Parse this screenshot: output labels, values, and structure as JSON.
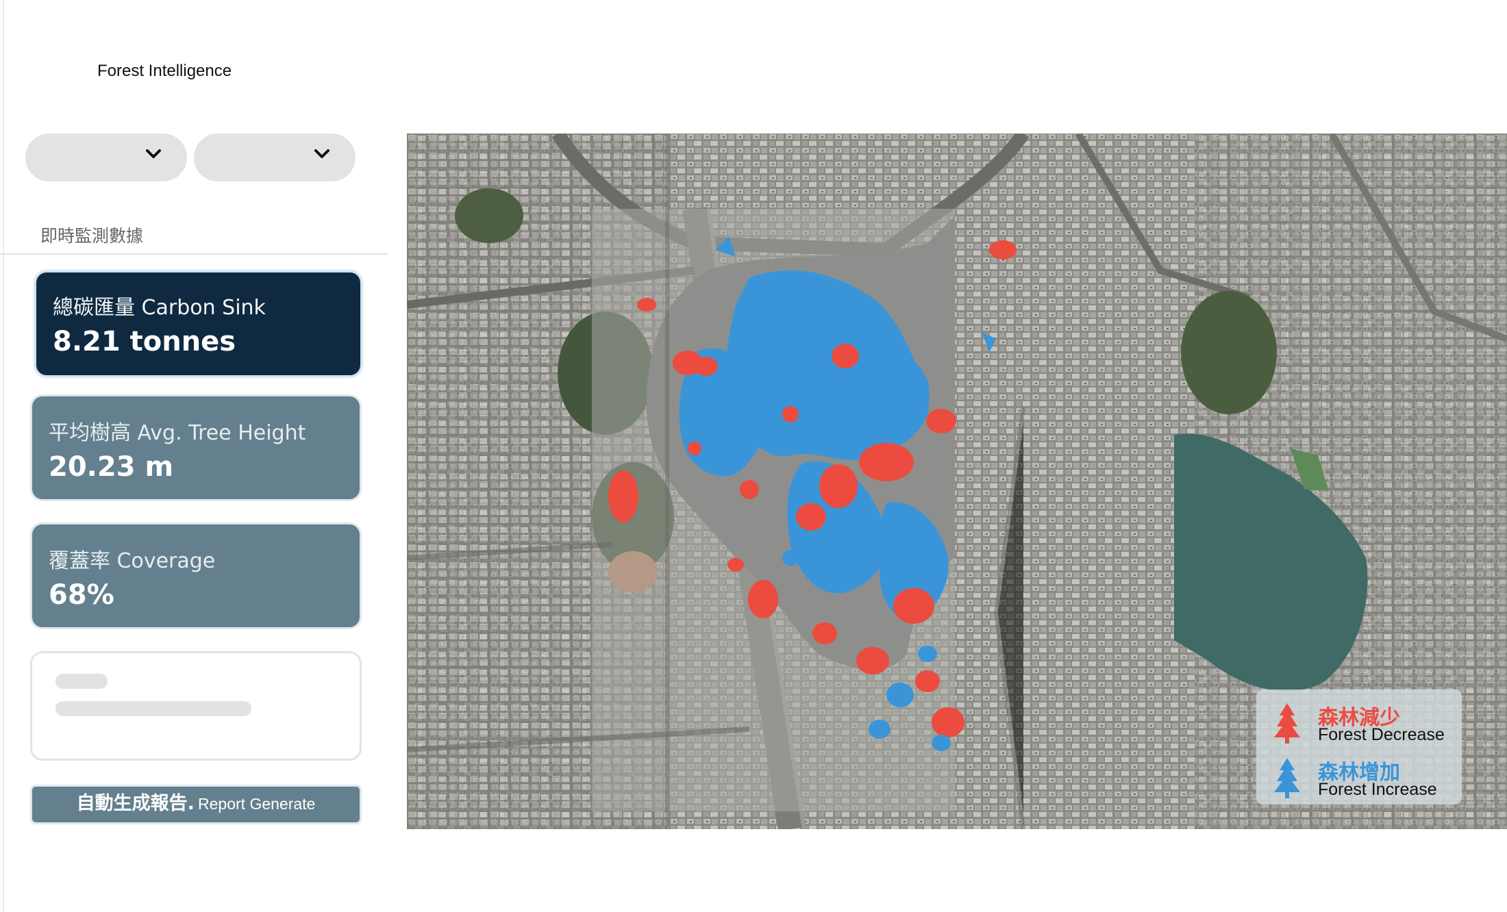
{
  "app": {
    "title": "Forest Intelligence"
  },
  "filters": {
    "select_1": {
      "value": ""
    },
    "select_2": {
      "value": ""
    }
  },
  "section": {
    "title": "即時監測數據"
  },
  "metrics": [
    {
      "label": "總碳匯量 Carbon Sink",
      "value": "8.21 tonnes"
    },
    {
      "label": "平均樹高 Avg. Tree Height",
      "value": "20.23 m"
    },
    {
      "label": "覆蓋率 Coverage",
      "value": "68%"
    }
  ],
  "report": {
    "label_zh": "自動生成報告.",
    "label_en": "Report Generate"
  },
  "map": {
    "legend": {
      "decrease": {
        "zh": "森林減少",
        "en": "Forest Decrease",
        "color": "#ec4b3f"
      },
      "increase": {
        "zh": "森林增加",
        "en": "Forest Increase",
        "color": "#3a95d8"
      }
    }
  },
  "colors": {
    "accent_dark": "#0f2a40",
    "card_gray": "#64808e",
    "decrease": "#ec4b3f",
    "increase": "#3a95d8"
  }
}
